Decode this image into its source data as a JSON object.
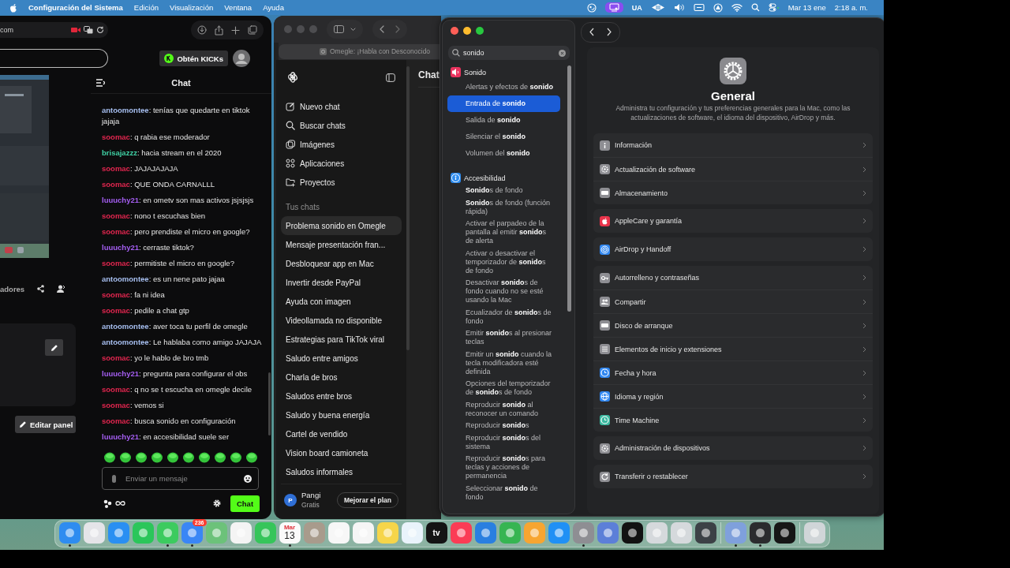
{
  "menubar": {
    "app": "Configuración del Sistema",
    "menus": [
      "Edición",
      "Visualización",
      "Ventana",
      "Ayuda"
    ],
    "input_source": "UA",
    "date": "Mar 13 ene",
    "time": "2:18 a. m."
  },
  "kick": {
    "address": "com",
    "kicks_button": "Obtén KICKs",
    "chat_title": "Chat",
    "channel_tab": "adores",
    "edit_panel": "Editar panel",
    "message_placeholder": "Enviar un mensaje",
    "send_button": "Chat",
    "messages": [
      {
        "text": "**antoomontee**: tenías que quedarte en tiktok jajaja",
        "color": "#a7bff0"
      },
      {
        "text": "**soomac**: q rabia ese moderador",
        "color": "#e2264f"
      },
      {
        "text": "**brisajazzz**: hacia stream en el 2020",
        "color": "#3fcfa3"
      },
      {
        "text": "**soomac**: JAJAJAJAJA",
        "color": "#e2264f"
      },
      {
        "text": "**soomac**: QUE ONDA CARNALLL",
        "color": "#e2264f"
      },
      {
        "text": "**luuuchy21**: en ometv son mas activos jsjsjsjs",
        "color": "#a55ef2"
      },
      {
        "text": "**soomac**: nono t escuchas bien",
        "color": "#e2264f"
      },
      {
        "text": "**soomac**: pero prendiste el micro en google?",
        "color": "#e2264f"
      },
      {
        "text": "**luuuchy21**: cerraste tiktok?",
        "color": "#a55ef2"
      },
      {
        "text": "**soomac**: permitiste el micro en google?",
        "color": "#e2264f"
      },
      {
        "text": "**antoomontee**: es un nene pato jajaa",
        "color": "#a7bff0"
      },
      {
        "text": "**soomac**: fa ni idea",
        "color": "#e2264f"
      },
      {
        "text": "**soomac**: pedile a chat gtp",
        "color": "#e2264f"
      },
      {
        "text": "**antoomontee**: aver toca tu perfil de omegle",
        "color": "#a7bff0"
      },
      {
        "text": "**antoomontee**: Le hablaba como amigo JAJAJA",
        "color": "#a7bff0"
      },
      {
        "text": "**soomac**: yo le hablo de bro tmb",
        "color": "#e2264f"
      },
      {
        "text": "**luuuchy21**: pregunta para configurar el obs",
        "color": "#a55ef2"
      },
      {
        "text": "**soomac**: q no se t escucha en omegle decile",
        "color": "#e2264f"
      },
      {
        "text": "**soomac**: vemos si",
        "color": "#e2264f"
      },
      {
        "text": "**soomac**: busca sonido en configuración",
        "color": "#e2264f"
      },
      {
        "text": "**luuuchy21**: en accesibilidad suele ser",
        "color": "#a55ef2"
      }
    ]
  },
  "browser": {
    "address": "Omegle: ¡Habla con Desconocido",
    "main_title": "Chat",
    "menu": [
      {
        "label": "Nuevo chat",
        "kind": "edit"
      },
      {
        "label": "Buscar chats",
        "kind": "search"
      },
      {
        "label": "Imágenes",
        "kind": "images"
      },
      {
        "label": "Aplicaciones",
        "kind": "apps"
      },
      {
        "label": "Proyectos",
        "kind": "folder"
      }
    ],
    "chats_heading": "Tus chats",
    "chats": [
      {
        "label": "Problema sonido en Omegle",
        "selected": true
      },
      {
        "label": "Mensaje presentación fran...",
        "selected": false
      },
      {
        "label": "Desbloquear app en Mac",
        "selected": false
      },
      {
        "label": "Invertir desde PayPal",
        "selected": false
      },
      {
        "label": "Ayuda con imagen",
        "selected": false
      },
      {
        "label": "Videollamada no disponible",
        "selected": false
      },
      {
        "label": "Estrategias para TikTok viral",
        "selected": false
      },
      {
        "label": "Saludo entre amigos",
        "selected": false
      },
      {
        "label": "Charla de bros",
        "selected": false
      },
      {
        "label": "Saludos entre bros",
        "selected": false
      },
      {
        "label": "Saludo y buena energía",
        "selected": false
      },
      {
        "label": "Cartel de vendido",
        "selected": false
      },
      {
        "label": "Vision board camioneta",
        "selected": false
      },
      {
        "label": "Saludos informales",
        "selected": false
      }
    ],
    "user": {
      "initial": "P",
      "name": "Pangi",
      "plan": "Gratis"
    },
    "upgrade_button": "Mejorar el plan"
  },
  "settings": {
    "search": "sonido",
    "results": [
      {
        "title": "Sonido",
        "kind": "sound",
        "items": [
          {
            "text": "Alertas y efectos de **sonido**",
            "selected": false
          },
          {
            "text": "Entrada de **sonido**",
            "selected": true
          },
          {
            "text": "Salida de **sonido**",
            "selected": false
          },
          {
            "text": "Silenciar el **sonido**",
            "selected": false
          },
          {
            "text": "Volumen del **sonido**",
            "selected": false
          }
        ]
      },
      {
        "title": "Accesibilidad",
        "kind": "accessibility",
        "items": [
          {
            "text": "**Sonido**s de fondo",
            "selected": false
          },
          {
            "text": "**Sonido**s de fondo (función rápida)",
            "selected": false
          },
          {
            "text": "Activar el parpadeo de la pantalla al emitir **sonido**s de alerta",
            "selected": false
          },
          {
            "text": "Activar o desactivar el temporizador de **sonido**s de fondo",
            "selected": false
          },
          {
            "text": "Desactivar **sonido**s de fondo cuando no se esté usando la Mac",
            "selected": false
          },
          {
            "text": "Ecualizador de **sonido**s de fondo",
            "selected": false
          },
          {
            "text": "Emitir **sonido**s al presionar teclas",
            "selected": false
          },
          {
            "text": "Emitir un **sonido** cuando la tecla modificadora esté definida",
            "selected": false
          },
          {
            "text": "Opciones del temporizador de **sonido**s de fondo",
            "selected": false
          },
          {
            "text": "Reproducir **sonido** al reconocer un comando",
            "selected": false
          },
          {
            "text": "Reproducir **sonido**s",
            "selected": false
          },
          {
            "text": "Reproducir **sonido**s del sistema",
            "selected": false
          },
          {
            "text": "Reproducir **sonido**s para teclas y acciones de permanencia",
            "selected": false
          },
          {
            "text": "Seleccionar **sonido** de fondo",
            "selected": false
          }
        ]
      }
    ],
    "detail": {
      "title": "General",
      "description": "Administra tu configuración y tus preferencias generales para la Mac, como las actualizaciones de software, el idioma del dispositivo, AirDrop y más.",
      "groups": [
        {
          "rows": [
            {
              "label": "Información",
              "kind": "info",
              "color": "#8e8e93"
            },
            {
              "label": "Actualización de software",
              "kind": "gear",
              "color": "#8e8e93"
            },
            {
              "label": "Almacenamiento",
              "kind": "drive",
              "color": "#8e8e93"
            }
          ]
        },
        {
          "rows": [
            {
              "label": "AppleCare y garantía",
              "kind": "apple",
              "color": "#e8334a"
            }
          ]
        },
        {
          "rows": [
            {
              "label": "AirDrop y Handoff",
              "kind": "rings",
              "color": "#2f86f0"
            }
          ]
        },
        {
          "rows": [
            {
              "label": "Autorrelleno y contraseñas",
              "kind": "key",
              "color": "#8e8e93"
            },
            {
              "label": "Compartir",
              "kind": "people",
              "color": "#8e8e93"
            },
            {
              "label": "Disco de arranque",
              "kind": "drive",
              "color": "#8e8e93"
            },
            {
              "label": "Elementos de inicio y extensiones",
              "kind": "list",
              "color": "#8e8e93"
            },
            {
              "label": "Fecha y hora",
              "kind": "clock",
              "color": "#2f86f0"
            },
            {
              "label": "Idioma y región",
              "kind": "globe",
              "color": "#2f86f0"
            },
            {
              "label": "Time Machine",
              "kind": "clock",
              "color": "#3bb8a0"
            }
          ]
        },
        {
          "rows": [
            {
              "label": "Administración de dispositivos",
              "kind": "gear",
              "color": "#8e8e93"
            }
          ]
        },
        {
          "rows": [
            {
              "label": "Transferir o restablecer",
              "kind": "arrow",
              "color": "#8e8e93"
            }
          ]
        }
      ]
    }
  },
  "dock": [
    {
      "color": "#2e8cf0",
      "running": true
    },
    {
      "color": "#e4e4e8",
      "running": false
    },
    {
      "color": "#2a8ff2",
      "running": false
    },
    {
      "color": "#2bc65a",
      "running": false
    },
    {
      "color": "#3ccb5f",
      "running": true
    },
    {
      "color": "#3a86f5",
      "running": true,
      "badge": "236"
    },
    {
      "color": "#6cc27a",
      "running": false
    },
    {
      "color": "#f4f4f4",
      "running": false
    },
    {
      "color": "#36c55a",
      "running": false
    },
    {
      "color": "#fafafa",
      "running": true,
      "month": "Mar",
      "day": "13"
    },
    {
      "color": "#a89b8c",
      "running": false
    },
    {
      "color": "#f7f7f7",
      "running": false
    },
    {
      "color": "#f5f5f5",
      "running": false
    },
    {
      "color": "#f6d54a",
      "running": false
    },
    {
      "color": "#e9f3fb",
      "running": false
    },
    {
      "color": "#141414",
      "running": false,
      "label": "tv"
    },
    {
      "color": "#fb3c55",
      "running": false
    },
    {
      "color": "#2a7fe0",
      "running": false
    },
    {
      "color": "#36b552",
      "running": false
    },
    {
      "color": "#f7a531",
      "running": false
    },
    {
      "color": "#2090f5",
      "running": false
    },
    {
      "color": "#8e8e93",
      "running": true
    },
    {
      "color": "#5c7fd8",
      "running": false
    },
    {
      "color": "#121212",
      "running": false
    },
    {
      "color": "#d5d9dc",
      "running": false
    },
    {
      "color": "#d5d9dc",
      "running": false
    },
    {
      "color": "#3c4146",
      "running": false
    },
    {
      "color": "#7fa0dc",
      "running": true,
      "separator_before": true
    },
    {
      "color": "#2b2b2e",
      "running": true
    },
    {
      "color": "#161616",
      "running": false
    },
    {
      "color": "#d0d5d8",
      "running": false,
      "separator_before": true
    }
  ]
}
